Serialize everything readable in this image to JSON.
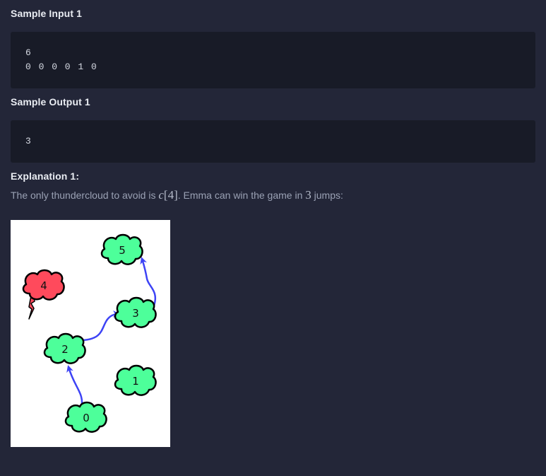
{
  "sample_input": {
    "heading": "Sample Input 1",
    "lines": [
      "6",
      "0 0 0 0 1 0"
    ]
  },
  "sample_output": {
    "heading": "Sample Output 1",
    "lines": [
      "3"
    ]
  },
  "explanation": {
    "heading": "Explanation 1:",
    "text_before": "The only thundercloud to avoid is ",
    "math_var": "c",
    "math_index": "[4]",
    "text_middle": ". Emma can win the game in ",
    "math_jumps": "3",
    "text_after": " jumps:"
  },
  "figure": {
    "clouds": [
      {
        "label": "0",
        "kind": "cumulus",
        "color": "#4dff9a"
      },
      {
        "label": "1",
        "kind": "cumulus",
        "color": "#4dff9a"
      },
      {
        "label": "2",
        "kind": "cumulus",
        "color": "#4dff9a"
      },
      {
        "label": "3",
        "kind": "cumulus",
        "color": "#4dff9a"
      },
      {
        "label": "4",
        "kind": "thundercloud",
        "color": "#ff4a5c"
      },
      {
        "label": "5",
        "kind": "cumulus",
        "color": "#4dff9a"
      }
    ],
    "jumps": [
      [
        "0",
        "2"
      ],
      [
        "2",
        "3"
      ],
      [
        "3",
        "5"
      ]
    ],
    "arrow_color": "#3d43f5"
  }
}
